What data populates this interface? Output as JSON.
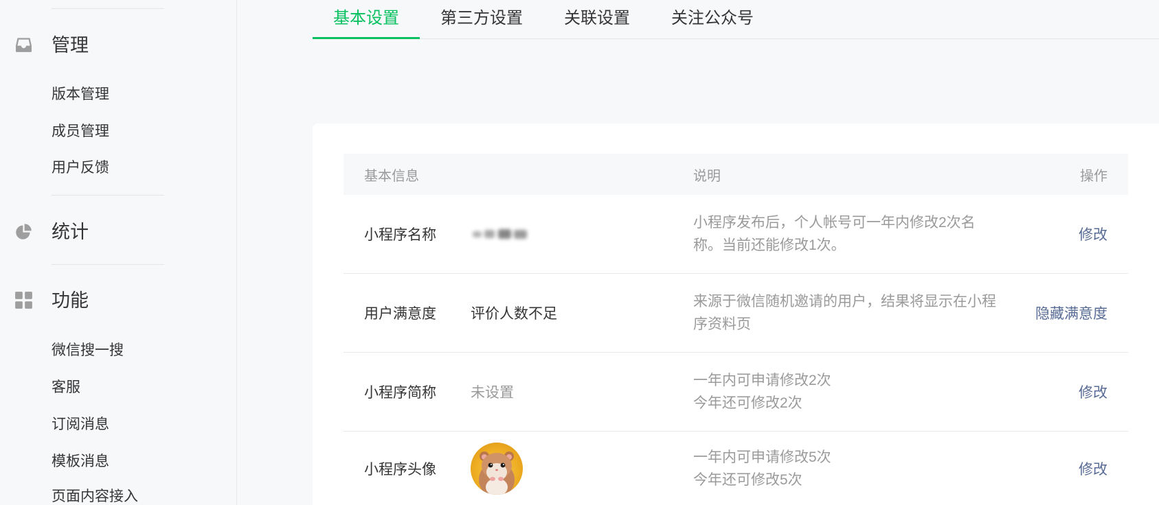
{
  "colors": {
    "accent": "#07c160",
    "link": "#576b95"
  },
  "sidebar": {
    "sections": [
      {
        "title": "管理",
        "icon": "inbox-icon",
        "items": [
          "版本管理",
          "成员管理",
          "用户反馈"
        ]
      },
      {
        "title": "统计",
        "icon": "pie-chart-icon",
        "items": []
      },
      {
        "title": "功能",
        "icon": "grid-icon",
        "items": [
          "微信搜一搜",
          "客服",
          "订阅消息",
          "模板消息",
          "页面内容接入"
        ]
      }
    ]
  },
  "tabs": [
    {
      "label": "基本设置",
      "active": true
    },
    {
      "label": "第三方设置",
      "active": false
    },
    {
      "label": "关联设置",
      "active": false
    },
    {
      "label": "关注公众号",
      "active": false
    }
  ],
  "table": {
    "headers": {
      "info": "基本信息",
      "desc": "说明",
      "action": "操作"
    },
    "rows": [
      {
        "label": "小程序名称",
        "desc": [
          "小程序发布后，个人帐号可一年内修改2次名",
          "称。当前还能修改1次。"
        ],
        "action": "修改"
      },
      {
        "label": "用户满意度",
        "value": "评价人数不足",
        "desc": [
          "来源于微信随机邀请的用户，结果将显示在小程",
          "序资料页"
        ],
        "action": "隐藏满意度"
      },
      {
        "label": "小程序简称",
        "value": "未设置",
        "desc": [
          "一年内可申请修改2次",
          "今年还可修改2次"
        ],
        "action": "修改"
      },
      {
        "label": "小程序头像",
        "desc": [
          "一年内可申请修改5次",
          "今年还可修改5次"
        ],
        "action": "修改"
      }
    ]
  }
}
